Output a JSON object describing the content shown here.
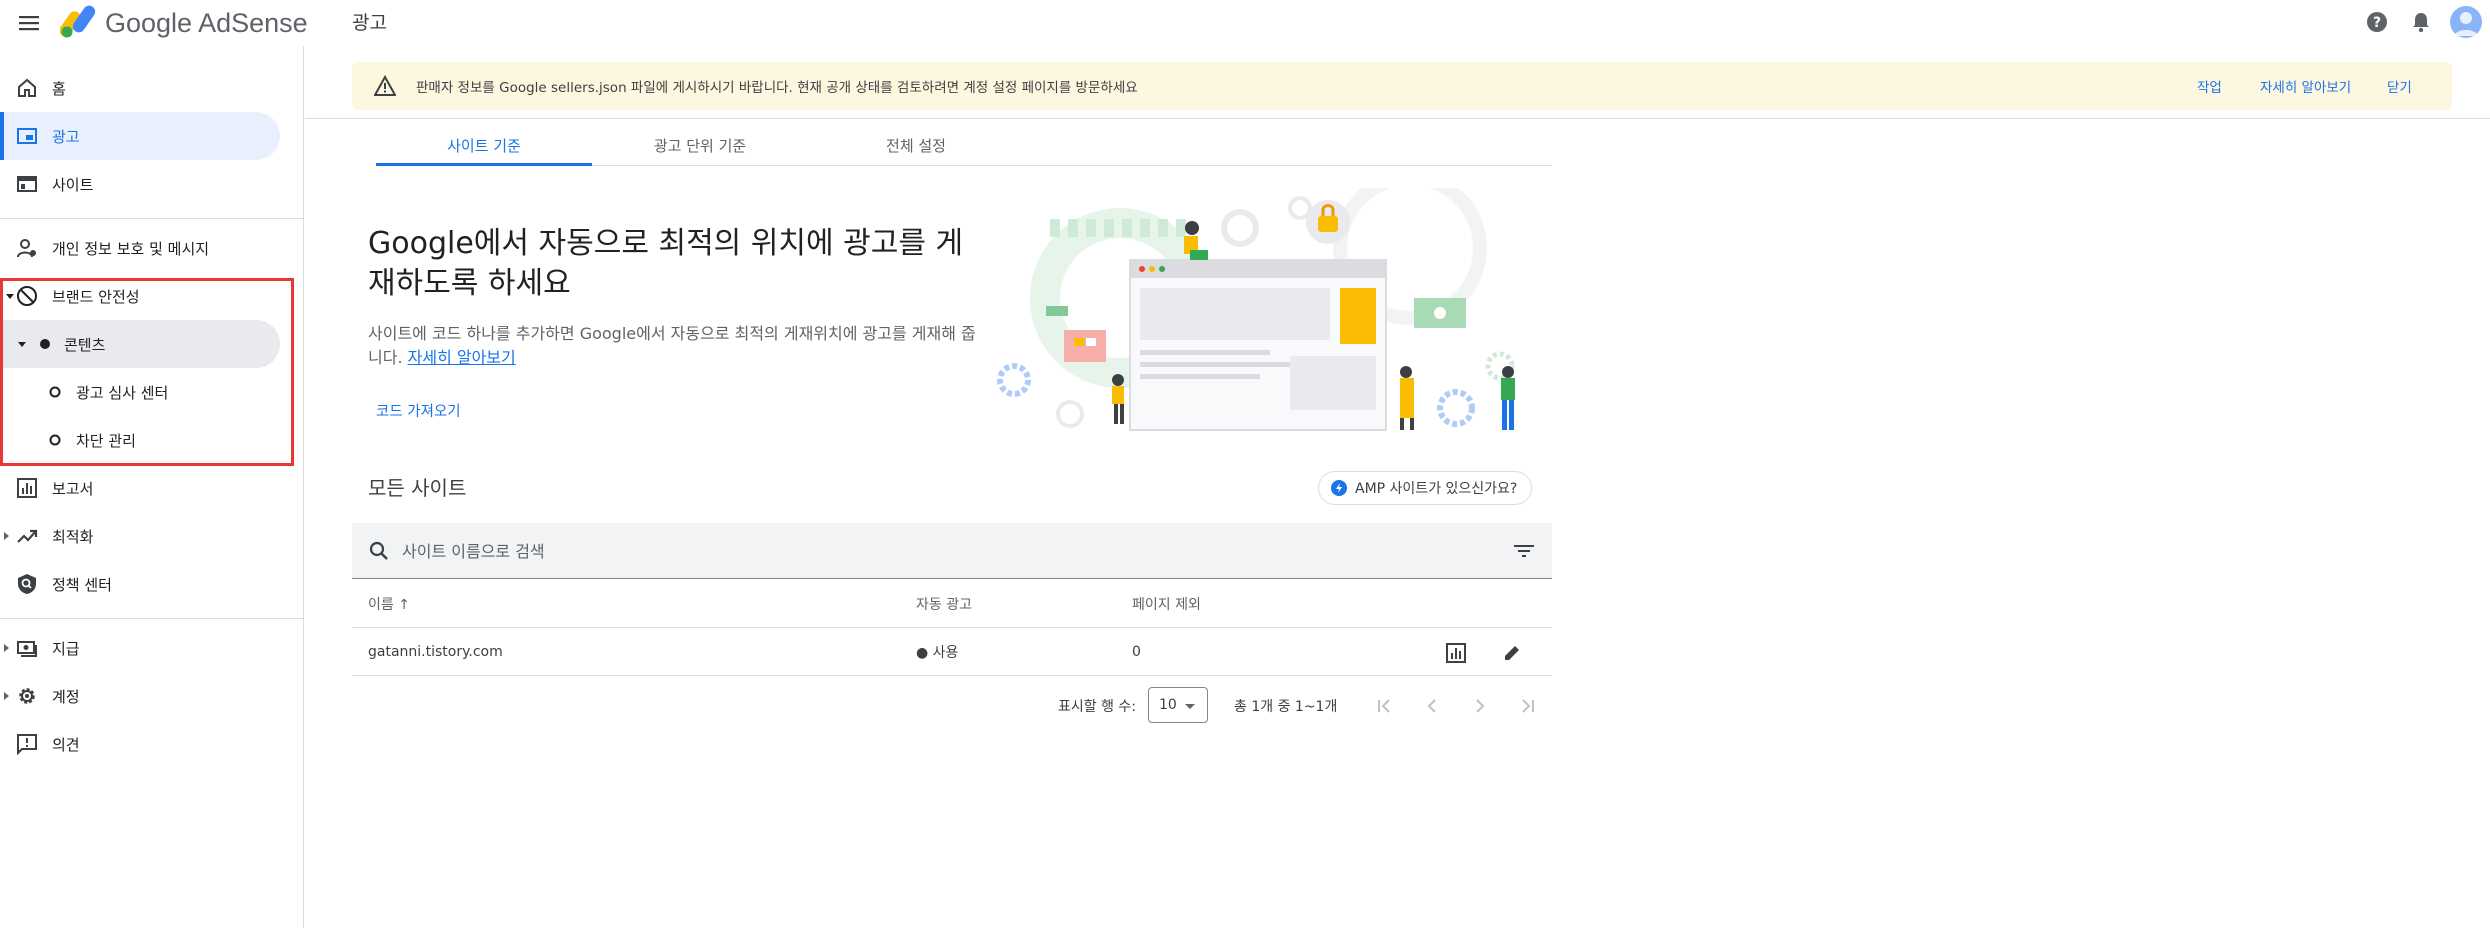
{
  "app": {
    "logo_text": "Google AdSense",
    "page_title": "광고"
  },
  "sidebar": {
    "items": [
      {
        "label": "홈",
        "icon": "home-icon"
      },
      {
        "label": "광고",
        "icon": "ads-icon"
      },
      {
        "label": "사이트",
        "icon": "sites-icon"
      },
      {
        "label": "개인 정보 보호 및 메시지",
        "icon": "privacy-messaging-icon"
      },
      {
        "label": "브랜드 안전성",
        "icon": "block-icon"
      },
      {
        "label": "콘텐츠",
        "icon": "dot-icon"
      },
      {
        "label": "광고 심사 센터",
        "icon": "circle-icon"
      },
      {
        "label": "차단 관리",
        "icon": "circle-icon"
      },
      {
        "label": "보고서",
        "icon": "reports-icon"
      },
      {
        "label": "최적화",
        "icon": "trending-icon"
      },
      {
        "label": "정책 센터",
        "icon": "policy-icon"
      },
      {
        "label": "지급",
        "icon": "payments-icon"
      },
      {
        "label": "계정",
        "icon": "gear-icon"
      },
      {
        "label": "의견",
        "icon": "feedback-icon"
      }
    ]
  },
  "banner": {
    "message": "판매자 정보를 Google sellers.json 파일에 게시하시기 바랍니다. 현재 공개 상태를 검토하려면 계정 설정 페이지를 방문하세요",
    "action_label": "작업",
    "learn_more_label": "자세히 알아보기",
    "close_label": "닫기"
  },
  "tabs": [
    {
      "label": "사이트 기준",
      "active": true
    },
    {
      "label": "광고 단위 기준",
      "active": false
    },
    {
      "label": "전체 설정",
      "active": false
    }
  ],
  "hero": {
    "title": "Google에서 자동으로 최적의 위치에 광고를 게재하도록 하세요",
    "description": "사이트에 코드 하나를 추가하면 Google에서 자동으로 최적의 게재위치에 광고를 게재해 줍니다.",
    "learn_more_link": "자세히 알아보기",
    "get_code_label": "코드 가져오기"
  },
  "sites": {
    "section_title": "모든 사이트",
    "amp_chip_label": "AMP 사이트가 있으신가요?",
    "search_placeholder": "사이트 이름으로 검색",
    "columns": {
      "name": "이름 ↑",
      "auto_ads": "자동 광고",
      "page_exclusions": "페이지 제외"
    },
    "rows": [
      {
        "name": "gatanni.tistory.com",
        "auto_ads": "● 사용",
        "page_exclusions": "0"
      }
    ]
  },
  "pagination": {
    "rows_per_page_label": "표시할 행 수:",
    "rows_per_page_value": "10",
    "range_text": "총 1개 중 1~1개"
  },
  "colors": {
    "accent": "#1a73e8",
    "banner_bg": "#fef7e0",
    "success": "#188038",
    "highlight": "#e53935"
  }
}
